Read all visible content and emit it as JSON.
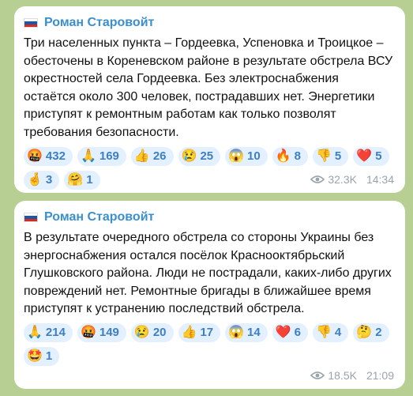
{
  "posts": [
    {
      "author": "Роман Старовойт",
      "text": "Три населенных пункта – Гордеевка, Успеновка и Троицкое – обесточены в Кореневском районе в результате обстрела ВСУ окрестностей села Гордеевка. Без электроснабжения остаётся около 300 человек, пострадавших нет. Энергетики приступят к ремонтным работам как только позволят требования безопасности.",
      "reactions": [
        {
          "emoji": "🤬",
          "count": "432"
        },
        {
          "emoji": "🙏",
          "count": "169"
        },
        {
          "emoji": "👍",
          "count": "26"
        },
        {
          "emoji": "😢",
          "count": "25"
        },
        {
          "emoji": "😱",
          "count": "10"
        },
        {
          "emoji": "🔥",
          "count": "8"
        },
        {
          "emoji": "👎",
          "count": "5"
        },
        {
          "emoji": "❤️",
          "count": "5"
        },
        {
          "emoji": "🤞",
          "count": "3"
        },
        {
          "emoji": "🤗",
          "count": "1"
        }
      ],
      "views": "32.3K",
      "time": "14:34"
    },
    {
      "author": "Роман Старовойт",
      "text": "В результате очередного обстрела со стороны Украины без энергоснабжения остался посёлок Краснооктябрьский Глушковского района. Люди не пострадали, каких-либо других повреждений нет. Ремонтные бригады в ближайшее время приступят к устранению последствий обстрела.",
      "reactions": [
        {
          "emoji": "🙏",
          "count": "214"
        },
        {
          "emoji": "🤬",
          "count": "149"
        },
        {
          "emoji": "😢",
          "count": "20"
        },
        {
          "emoji": "👍",
          "count": "17"
        },
        {
          "emoji": "😱",
          "count": "14"
        },
        {
          "emoji": "❤️",
          "count": "6"
        },
        {
          "emoji": "👎",
          "count": "4"
        },
        {
          "emoji": "🤔",
          "count": "2"
        },
        {
          "emoji": "🤩",
          "count": "1"
        }
      ],
      "views": "18.5K",
      "time": "21:09"
    }
  ],
  "colors": {
    "accent": "#3a8fcf",
    "reaction_bg": "#e3f0ff",
    "reaction_text": "#3e7fc1",
    "meta": "#9aa3ab",
    "background": "#b7cf92",
    "flag": [
      "#ffffff",
      "#1c57a7",
      "#d52b1e"
    ]
  },
  "icons": {
    "flag": "russia-flag-icon",
    "views": "eye-icon"
  }
}
